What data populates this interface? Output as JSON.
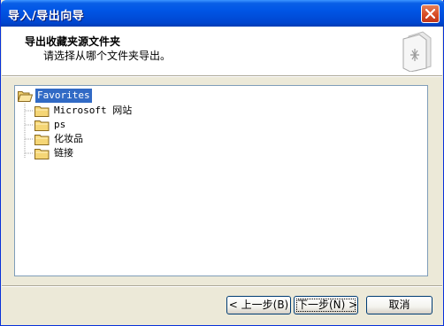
{
  "window": {
    "title": "导入/导出向导"
  },
  "header": {
    "title": "导出收藏夹源文件夹",
    "subtitle": "请选择从哪个文件夹导出。"
  },
  "tree": {
    "root": {
      "label": "Favorites",
      "icon": "folder-open-icon",
      "selected": true
    },
    "children": [
      {
        "label": "Microsoft 网站",
        "icon": "folder-icon"
      },
      {
        "label": "ps",
        "icon": "folder-icon"
      },
      {
        "label": "化妆品",
        "icon": "folder-icon"
      },
      {
        "label": "链接",
        "icon": "folder-icon"
      }
    ]
  },
  "buttons": {
    "back": "< 上一步(B)",
    "next": "下一步(N) >",
    "cancel": "取消"
  },
  "colors": {
    "titlebar": "#0055E5",
    "dialog_bg": "#ECE9D8",
    "selection": "#316AC5",
    "folder": "#F5D676"
  }
}
